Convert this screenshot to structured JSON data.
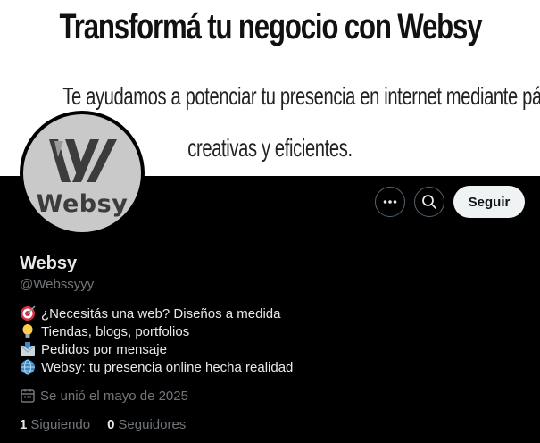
{
  "banner": {
    "headline": "Transformá tu negocio con Websy",
    "subtitle_line1": "Te ayudamos a potenciar tu presencia en internet mediante páginas web modernas,",
    "subtitle_line2": "creativas y eficientes."
  },
  "avatar": {
    "brand_text": "Websy"
  },
  "actions": {
    "more_icon": "more-icon",
    "search_icon": "search-icon",
    "follow_label": "Seguir"
  },
  "profile": {
    "name": "Websy",
    "handle": "@Webssyyy",
    "bio": [
      {
        "emoji": "target-icon",
        "text": "¿Necesitás una web? Diseños a medida"
      },
      {
        "emoji": "lightbulb-icon",
        "text": "Tiendas, blogs, portfolios"
      },
      {
        "emoji": "envelope-icon",
        "text": "Pedidos por mensaje"
      },
      {
        "emoji": "globe-icon",
        "text": "Websy: tu presencia online hecha realidad"
      }
    ],
    "joined": "Se unió el mayo de 2025",
    "following_count": "1",
    "following_label": "Siguiendo",
    "followers_count": "0",
    "followers_label": "Seguidores"
  },
  "colors": {
    "background": "#000000",
    "text_primary": "#e7e9ea",
    "text_secondary": "#71767b",
    "button_bg": "#eff3f4"
  }
}
